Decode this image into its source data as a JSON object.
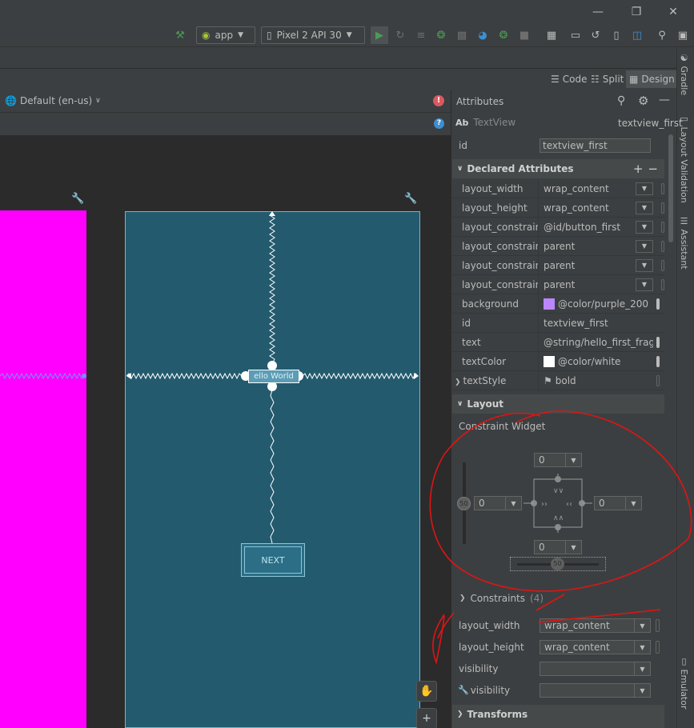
{
  "toolbar": {
    "app_config": "app",
    "device": "Pixel 2 API 30"
  },
  "view_modes": {
    "code": "Code",
    "split": "Split",
    "design": "Design"
  },
  "right_tabs": [
    "Gradle",
    "Layout Validation",
    "Assistant",
    "Emulator"
  ],
  "canvas": {
    "locale": "Default (en-us)",
    "hello_text": "ello World",
    "next_button": "NEXT"
  },
  "attributes": {
    "panel_title": "Attributes",
    "widget_type": "TextView",
    "widget_id": "textview_first",
    "id_label": "id",
    "id_value": "textview_first",
    "declared_header": "Declared Attributes",
    "declared": [
      {
        "key": "layout_width",
        "value": "wrap_content"
      },
      {
        "key": "layout_height",
        "value": "wrap_content"
      },
      {
        "key": "layout_constrain...",
        "value": "@id/button_first"
      },
      {
        "key": "layout_constrain...",
        "value": "parent"
      },
      {
        "key": "layout_constrain...",
        "value": "parent"
      },
      {
        "key": "layout_constrain...",
        "value": "parent"
      },
      {
        "key": "background",
        "value": "@color/purple_200"
      },
      {
        "key": "id",
        "value": "textview_first"
      },
      {
        "key": "text",
        "value": "@string/hello_first_fragm"
      },
      {
        "key": "textColor",
        "value": "@color/white"
      },
      {
        "key": "textStyle",
        "value": "bold"
      }
    ],
    "layout_header": "Layout",
    "constraint_widget_label": "Constraint Widget",
    "margin_top": "0",
    "margin_left": "0",
    "margin_right": "0",
    "margin_bottom": "0",
    "bias_vertical": "50",
    "bias_horizontal": "50",
    "constraints_label": "Constraints",
    "constraints_count": "(4)",
    "layout_rows": [
      {
        "key": "layout_width",
        "value": "wrap_content"
      },
      {
        "key": "layout_height",
        "value": "wrap_content"
      },
      {
        "key": "visibility",
        "value": ""
      },
      {
        "key": "visibility",
        "value": ""
      }
    ],
    "transforms_header": "Transforms"
  },
  "colors": {
    "purple_200": "#bb86fc",
    "white": "#ffffff",
    "magenta_preview": "#ff00ff",
    "blueprint": "#235a6e",
    "accent_run": "#499c54",
    "error": "#db5860"
  }
}
